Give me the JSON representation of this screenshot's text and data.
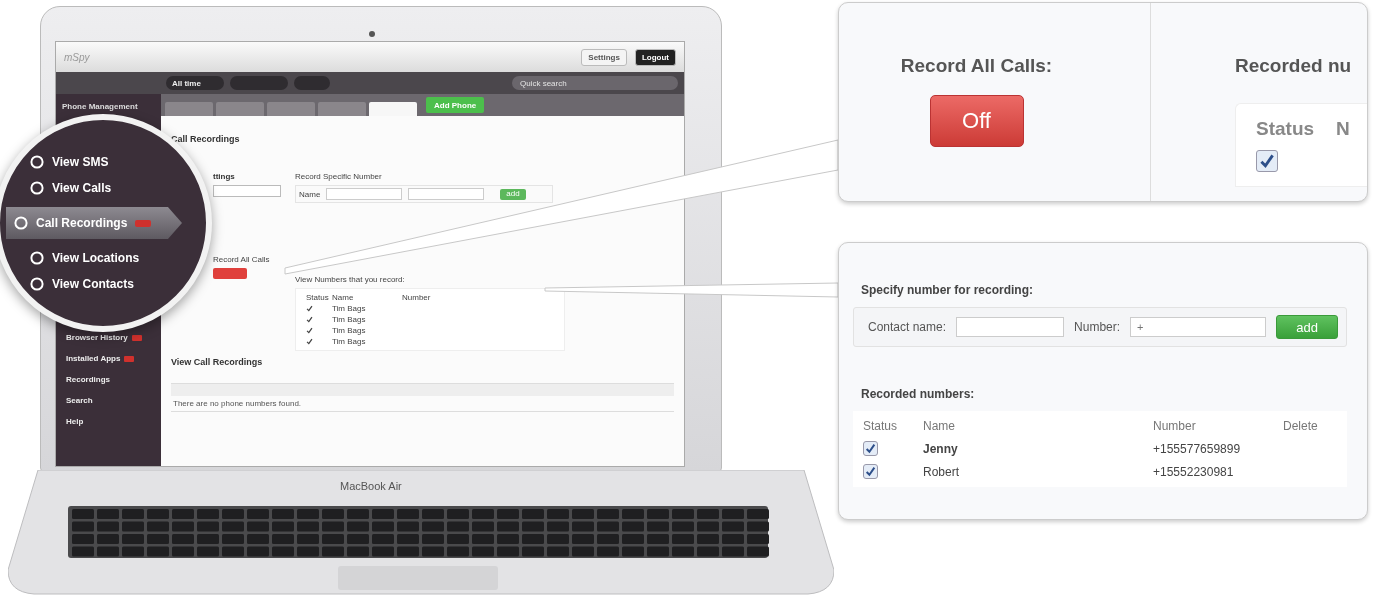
{
  "laptop": {
    "brand": "MacBook Air"
  },
  "app_header": {
    "logo": "mSpy",
    "settings": "Settings",
    "logout": "Logout"
  },
  "toolbar": {
    "period": "All time",
    "search": {
      "placeholder": "Quick search"
    }
  },
  "phone_tabs": [
    {
      "selected": false
    },
    {
      "selected": false
    },
    {
      "selected": false
    },
    {
      "selected": false
    },
    {
      "selected": true
    }
  ],
  "add_phone": "Add Phone",
  "sidebar": {
    "top": "Phone Management",
    "items": [
      {
        "label": "Browser History",
        "badge": true
      },
      {
        "label": "Installed Apps",
        "badge": true
      },
      {
        "label": "Recordings",
        "badge": false
      },
      {
        "label": "Search",
        "badge": false
      },
      {
        "label": "Help",
        "badge": false
      }
    ]
  },
  "magnifier": {
    "items": [
      {
        "label": "View SMS",
        "selected": false,
        "badge": false
      },
      {
        "label": "View Calls",
        "selected": false,
        "badge": false
      },
      {
        "label": "Call Recordings",
        "selected": true,
        "badge": true
      },
      {
        "label": "View Locations",
        "selected": false,
        "badge": false
      },
      {
        "label": "View Contacts",
        "selected": false,
        "badge": false
      }
    ]
  },
  "content": {
    "title": "Call Recordings",
    "settings_heading": "ttings",
    "record_all": {
      "label": "Record All Calls",
      "on": false
    },
    "specific": {
      "heading": "Record Specific Number",
      "name_label": "Name",
      "add": "add"
    },
    "list_heading": "View Numbers that you record:",
    "columns": [
      "Status",
      "Name",
      "Number"
    ],
    "rows": [
      {
        "name": "Tim Bags",
        "checked": true
      },
      {
        "name": "Tim Bags",
        "checked": true
      },
      {
        "name": "Tim Bags",
        "checked": true
      },
      {
        "name": "Tim Bags",
        "checked": true
      }
    ],
    "recordings_title": "View Call Recordings",
    "empty": "There are no phone numbers found."
  },
  "callout_record": {
    "label": "Record All Calls:",
    "on": false,
    "off_label": "Off",
    "recorded_heading": "Recorded nu",
    "columns": [
      "Status",
      "N"
    ],
    "checked": true
  },
  "callout_numbers": {
    "heading": "Specify number for recording:",
    "contact_label": "Contact name:",
    "number_label": "Number:",
    "number_placeholder": "+",
    "add": "add",
    "recorded_heading": "Recorded numbers:",
    "columns": [
      "Status",
      "Name",
      "Number",
      "Delete"
    ],
    "rows": [
      {
        "name": "Jenny",
        "number": "+155577659899",
        "checked": true,
        "bold": true
      },
      {
        "name": "Robert",
        "number": "+15552230981",
        "checked": true,
        "bold": false
      }
    ]
  }
}
